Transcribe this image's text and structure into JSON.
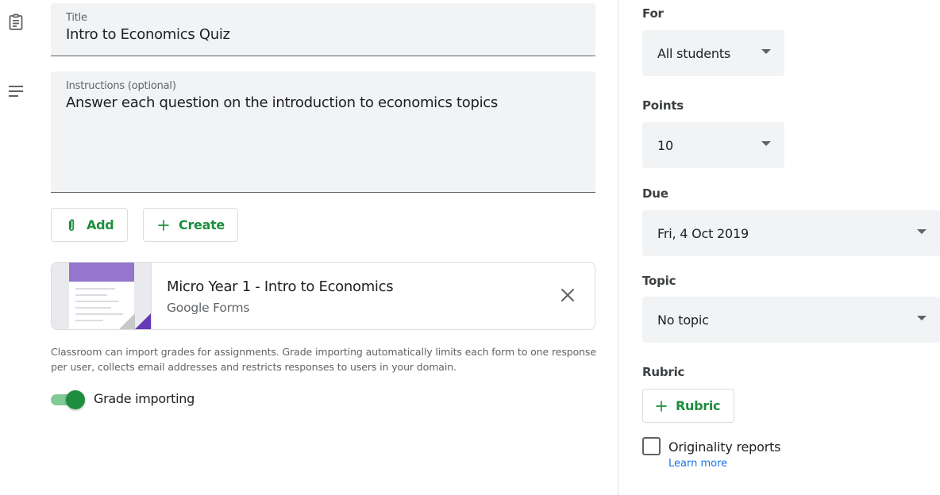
{
  "form": {
    "title_label": "Title",
    "title_value": "Intro to Economics Quiz",
    "instructions_label": "Instructions (optional)",
    "instructions_value": "Answer each question on the introduction to economics topics"
  },
  "buttons": {
    "add_label": "Add",
    "create_label": "Create"
  },
  "attachment": {
    "title": "Micro Year 1 - Intro to Economics",
    "subtitle": "Google Forms",
    "thumbnail_icon": "google-forms-thumbnail"
  },
  "grade_note": "Classroom can import grades for assignments. Grade importing automatically limits each form to one response per user, collects email addresses and restricts responses to users in your domain.",
  "grade_importing": {
    "label": "Grade importing",
    "enabled": true
  },
  "sidebar": {
    "for_label": "For",
    "for_value": "All students",
    "points_label": "Points",
    "points_value": "10",
    "due_label": "Due",
    "due_value": "Fri, 4 Oct 2019",
    "topic_label": "Topic",
    "topic_value": "No topic",
    "rubric_label": "Rubric",
    "rubric_button": "Rubric",
    "originality_label": "Originality reports",
    "originality_checked": false,
    "learn_more": "Learn more"
  },
  "icons": {
    "title_icon": "assignment-icon",
    "instructions_icon": "subject-icon",
    "add_icon": "paperclip-icon",
    "create_icon": "plus-icon",
    "close_icon": "close-icon",
    "rubric_icon": "plus-icon"
  },
  "colors": {
    "accent_green": "#1e8e3e",
    "toggle_track": "#81c995",
    "link_blue": "#1a73e8",
    "field_bg": "#f1f3f4",
    "forms_purple": "#673ab7"
  }
}
